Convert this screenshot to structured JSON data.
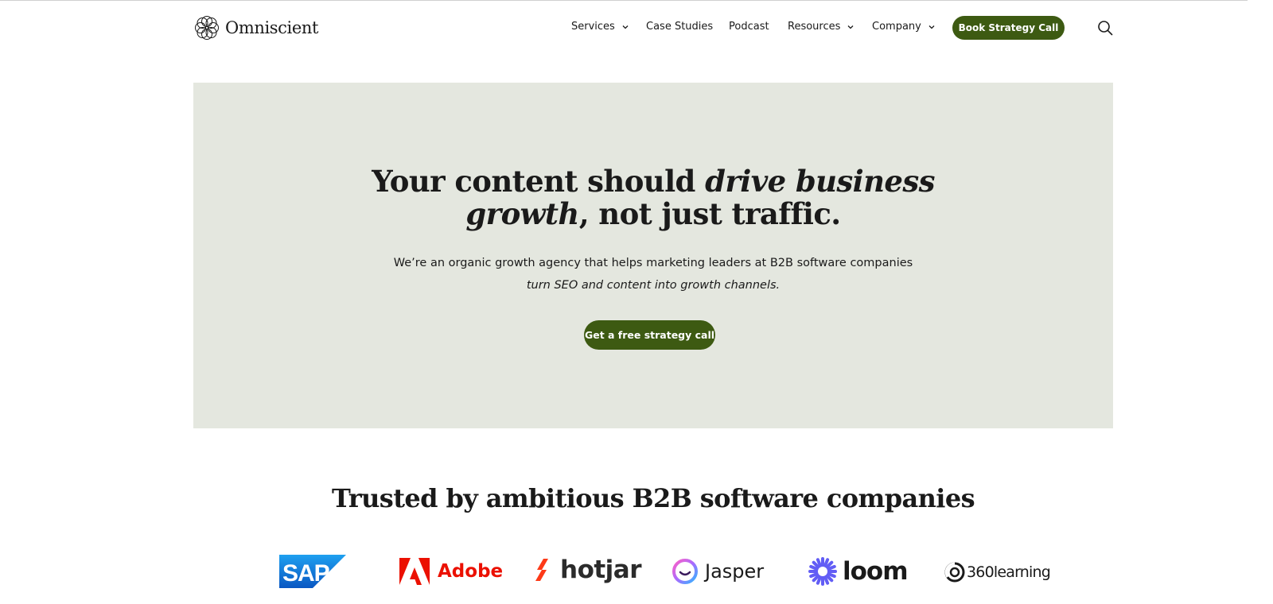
{
  "header": {
    "brand": "Omniscient",
    "nav": {
      "services": "Services",
      "case_studies": "Case Studies",
      "podcast": "Podcast",
      "resources": "Resources",
      "company": "Company"
    },
    "cta": "Book Strategy Call"
  },
  "hero": {
    "title_plain_1": "Your content should ",
    "title_em_1": "drive business",
    "title_em_2": "growth",
    "title_plain_2": ", not just traffic.",
    "subtitle_line1": "We’re an organic growth agency that helps marketing leaders at B2B software companies",
    "subtitle_line2": "turn SEO and content into growth channels.",
    "cta": "Get a free strategy call"
  },
  "trusted": {
    "title": "Trusted by ambitious B2B software companies",
    "logos": [
      "SAP",
      "Adobe",
      "hotjar",
      "Jasper",
      "loom",
      "360learning"
    ]
  },
  "colors": {
    "accent": "#3d5a12",
    "hero_bg": "#e4e7df",
    "sap_blue": "#1a73d6",
    "adobe_red": "#eb1000",
    "hotjar_orange": "#fd3a18",
    "loom_purple": "#625df5"
  }
}
